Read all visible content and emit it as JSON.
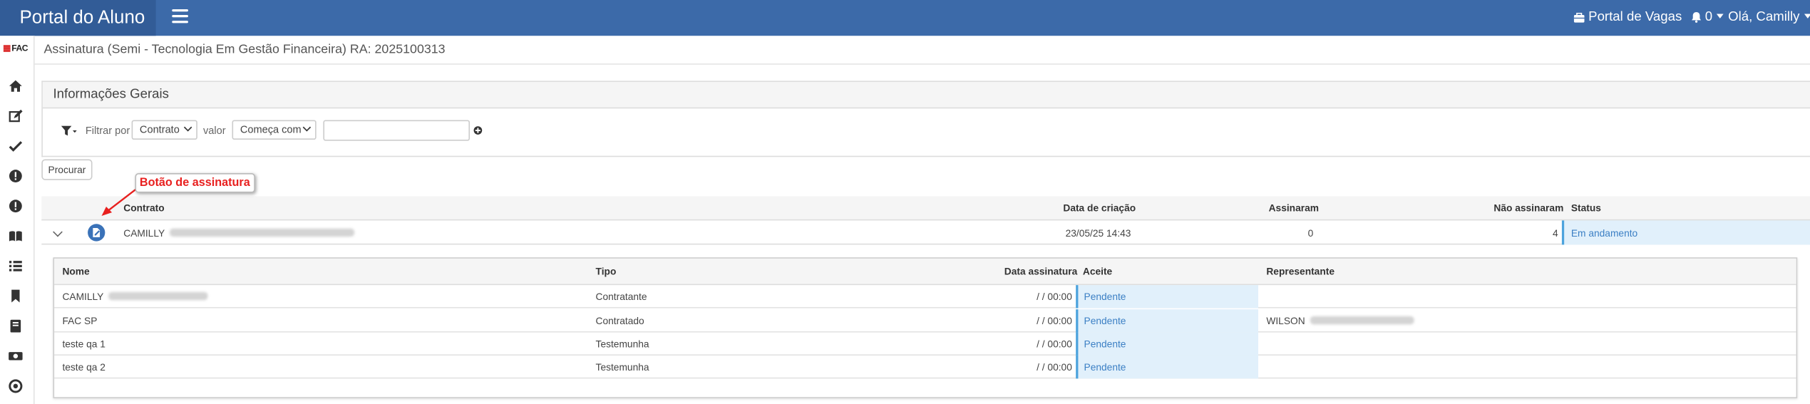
{
  "header": {
    "brand": "Portal do Aluno",
    "vagas_label": "Portal de Vagas",
    "notif_count": "0",
    "greeting": "Olá, Camilly"
  },
  "sidebar": {
    "logo": "FAC",
    "icons": [
      "home-icon",
      "edit-icon",
      "check-icon",
      "info-icon",
      "info-icon",
      "book-open-icon",
      "list-icon",
      "bookmark-icon",
      "book-icon",
      "money-icon",
      "support-icon"
    ]
  },
  "page_title": "Assinatura (Semi - Tecnologia Em Gestão Financeira) RA: 2025100313",
  "panel": {
    "title": "Informações Gerais",
    "filter_label": "Filtrar por",
    "filter_field": "Contrato",
    "value_label": "valor",
    "match_mode": "Começa com",
    "search_value": ""
  },
  "search_button": "Procurar",
  "annotation": "Botão de assinatura",
  "contracts_table": {
    "columns": [
      "Contrato",
      "Data de criação",
      "Assinaram",
      "Não assinaram",
      "Status"
    ],
    "rows": [
      {
        "contrato": "CAMILLY",
        "data": "23/05/25 14:43",
        "assinaram": "0",
        "nao_assinaram": "4",
        "status": "Em andamento"
      }
    ]
  },
  "signers_table": {
    "columns": [
      "Nome",
      "Tipo",
      "Data assinatura",
      "Aceite",
      "Representante"
    ],
    "rows": [
      {
        "nome": "CAMILLY",
        "tipo": "Contratante",
        "data": "/ / 00:00",
        "aceite": "Pendente",
        "representante": ""
      },
      {
        "nome": "FAC SP",
        "tipo": "Contratado",
        "data": "/ / 00:00",
        "aceite": "Pendente",
        "representante": "WILSON"
      },
      {
        "nome": "teste qa 1",
        "tipo": "Testemunha",
        "data": "/ / 00:00",
        "aceite": "Pendente",
        "representante": ""
      },
      {
        "nome": "teste qa 2",
        "tipo": "Testemunha",
        "data": "/ / 00:00",
        "aceite": "Pendente",
        "representante": ""
      }
    ]
  },
  "colors": {
    "topbar": "#3c6aa9",
    "brand_bg": "#325c97",
    "status_bg": "#e1f0fb",
    "link": "#3b7fc4",
    "annotation": "#e8201f"
  }
}
